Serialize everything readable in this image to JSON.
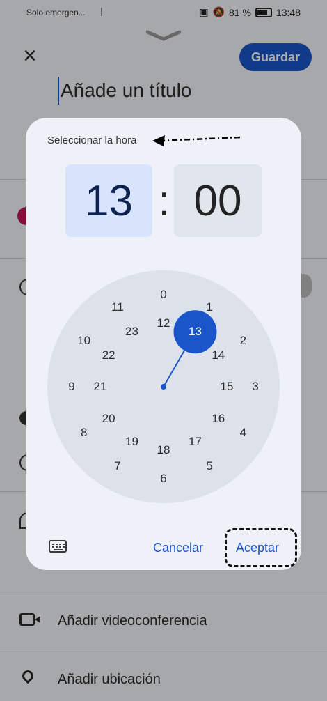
{
  "status_bar": {
    "carrier": "Solo emergen...",
    "battery": "81 %",
    "time": "13:48"
  },
  "app": {
    "save_label": "Guardar",
    "title_placeholder": "Añade un título",
    "video_label": "Añadir videoconferencia",
    "location_label": "Añadir ubicación"
  },
  "time_picker": {
    "title": "Seleccionar la hora",
    "hour": "13",
    "separator": ":",
    "minute": "00",
    "selected_value": "13",
    "outer_ring": [
      "0",
      "1",
      "2",
      "3",
      "4",
      "5",
      "6",
      "7",
      "8",
      "9",
      "10",
      "11"
    ],
    "inner_ring": [
      "12",
      "13",
      "14",
      "15",
      "16",
      "17",
      "18",
      "19",
      "20",
      "21",
      "22",
      "23"
    ],
    "cancel_label": "Cancelar",
    "accept_label": "Aceptar"
  },
  "colors": {
    "accent": "#1a56c9",
    "hour_box": "#d8e4fb",
    "dialog_bg": "#eef1f7",
    "clock_face": "#dde2ea"
  }
}
